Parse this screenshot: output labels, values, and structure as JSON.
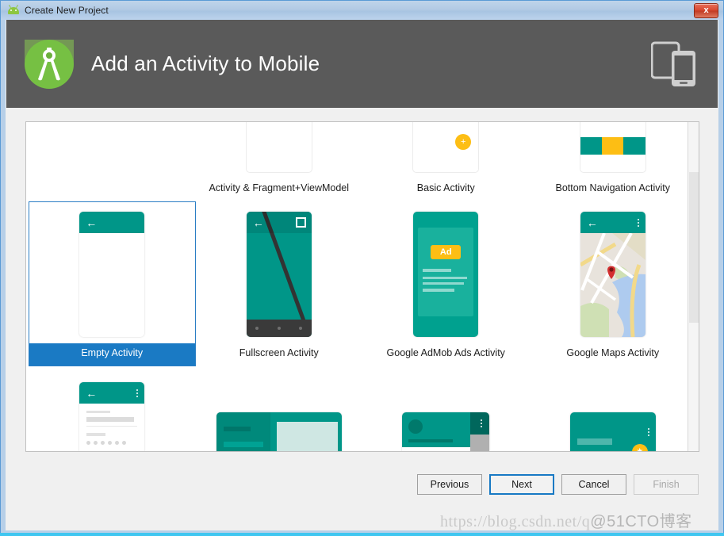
{
  "window": {
    "title": "Create New Project",
    "app_icon": "android-icon",
    "close_label": "x"
  },
  "header": {
    "title": "Add an Activity to Mobile",
    "logo": "android-studio-logo",
    "device_icon": "phone-tablet-icon"
  },
  "activities": [
    {
      "label": "",
      "thumb": "blank",
      "selected": false
    },
    {
      "label": "Activity & Fragment+ViewModel",
      "thumb": "blank-card",
      "selected": false
    },
    {
      "label": "Basic Activity",
      "thumb": "basic",
      "selected": false
    },
    {
      "label": "Bottom Navigation Activity",
      "thumb": "bottom-nav",
      "selected": false
    },
    {
      "label": "Empty Activity",
      "thumb": "empty",
      "selected": true
    },
    {
      "label": "Fullscreen Activity",
      "thumb": "fullscreen",
      "selected": false
    },
    {
      "label": "Google AdMob Ads Activity",
      "thumb": "admob",
      "selected": false
    },
    {
      "label": "Google Maps Activity",
      "thumb": "maps",
      "selected": false
    },
    {
      "label": "",
      "thumb": "login",
      "selected": false
    },
    {
      "label": "",
      "thumb": "master-detail",
      "selected": false
    },
    {
      "label": "",
      "thumb": "nav-drawer",
      "selected": false
    },
    {
      "label": "",
      "thumb": "scrolling",
      "selected": false
    }
  ],
  "admob": {
    "badge": "Ad"
  },
  "footer": {
    "previous": "Previous",
    "next": "Next",
    "cancel": "Cancel",
    "finish": "Finish"
  },
  "watermark": {
    "url": "https://blog.csdn.net/q",
    "site": "@51CTO博客"
  },
  "colors": {
    "header_bg": "#5a5a5a",
    "selection_blue": "#1a7ac4",
    "teal": "#009688",
    "amber": "#fdbe14",
    "android_green": "#8dc63f"
  }
}
